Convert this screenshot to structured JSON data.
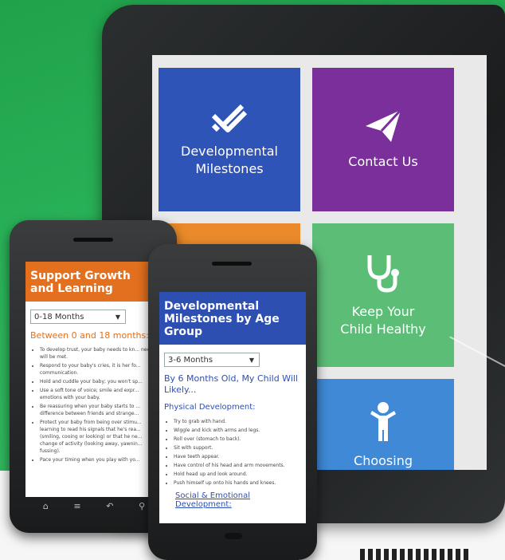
{
  "tablet": {
    "tiles": {
      "developmental": {
        "label": "Developmental\nMilestones",
        "icon": "double-check-icon",
        "color": "#2f54b8"
      },
      "contact": {
        "label": "Contact Us",
        "icon": "paper-plane-icon",
        "color": "#7a2f9b"
      },
      "health": {
        "label": "Keep Your\nChild Healthy",
        "icon": "stethoscope-icon",
        "color": "#5cbd77"
      },
      "choosing": {
        "label": "Choosing",
        "icon": "child-figure-icon",
        "color": "#3f89d6"
      },
      "orange": {
        "color": "#ea8a2a"
      }
    }
  },
  "phone_left": {
    "header": "Support Growth and Learning",
    "select_value": "0-18 Months",
    "subheading": "Between 0 and 18 months:",
    "bullets": [
      "To develop trust, your baby needs to kn... needs will be met.",
      "Respond to your baby's cries, it is her fo... communication.",
      "Hold and cuddle your baby; you won't sp...",
      "Use a soft tone of voice; smile and expr... emotions with your baby.",
      "Be reassuring when your baby starts to ... difference between friends and strange...",
      "Protect your baby from being over stimu... learning to read his signals that he's rea... (smiling, cooing or looking) or that he ne... change of activity (looking away, yawnin... fussing).",
      "Pace your timing when you play with yo..."
    ],
    "nav": [
      "⌂",
      "≡",
      "↶",
      "⚲"
    ]
  },
  "phone_right": {
    "header": "Developmental Milestones by Age Group",
    "select_value": "3-6 Months",
    "subheading": "By 6 Months Old, My Child Will Likely...",
    "section": "Physical Development:",
    "bullets": [
      "Try to grab with hand.",
      "Wiggle and kick with arms and legs.",
      "Roll over (stomach to back).",
      "Sit with support.",
      "Have teeth appear.",
      "Have control of his head and arm movements.",
      "Hold head up and look around.",
      "Push himself up onto his hands and knees."
    ],
    "section2": "Social & Emotional Development:"
  }
}
